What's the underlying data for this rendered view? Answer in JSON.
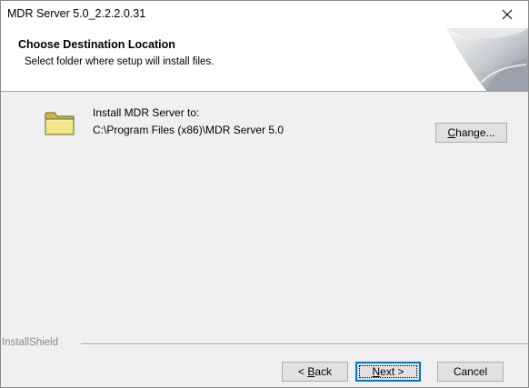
{
  "window": {
    "title": "MDR Server 5.0_2.2.2.0.31"
  },
  "header": {
    "title": "Choose Destination Location",
    "subtitle": "Select folder where setup will install files."
  },
  "destination": {
    "label": "Install MDR Server to:",
    "path": "C:\\Program Files (x86)\\MDR Server 5.0"
  },
  "buttons": {
    "change": {
      "mnemonic": "C",
      "rest": "hange..."
    },
    "back": {
      "prefix": "< ",
      "mnemonic": "B",
      "rest": "ack"
    },
    "next": {
      "mnemonic": "N",
      "rest": "ext >"
    },
    "cancel": "Cancel"
  },
  "footer": {
    "brand": "InstallShield"
  },
  "icons": {
    "close": "close-icon",
    "folder": "folder-icon",
    "header_art": "page-curl-art"
  },
  "colors": {
    "dialog_bg": "#f0f0f0",
    "header_bg": "#ffffff",
    "default_button_border": "#0078d7",
    "folder_yellow": "#f2e78b"
  }
}
